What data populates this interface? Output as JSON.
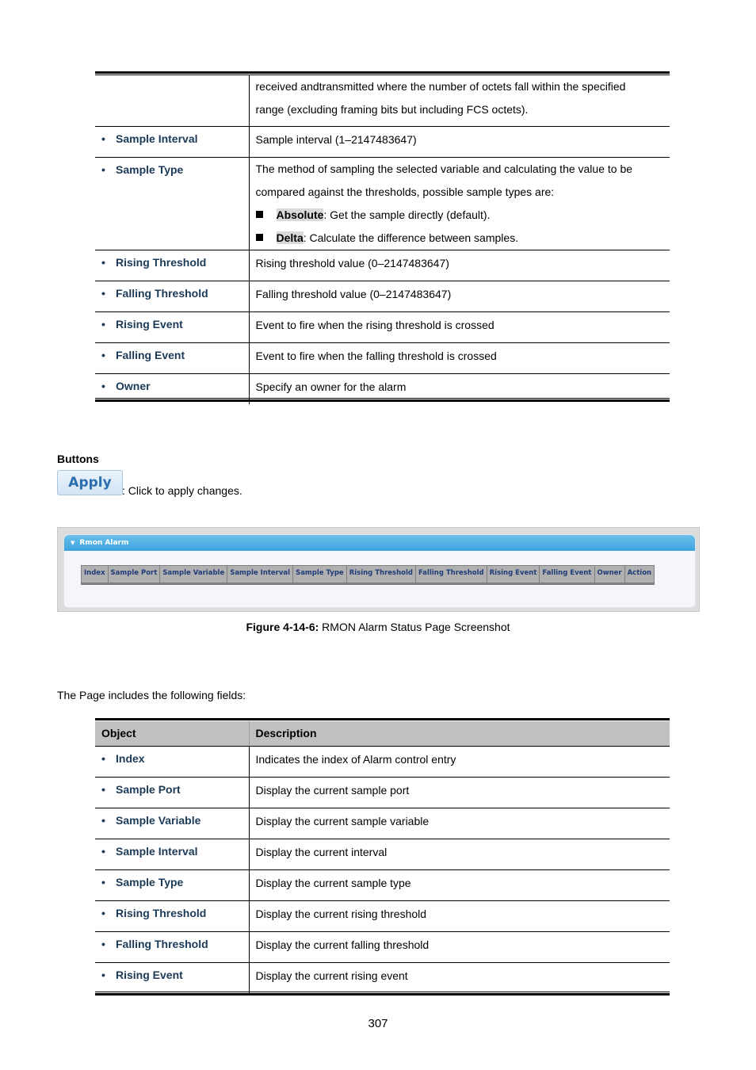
{
  "table1": {
    "continuation": {
      "lines": [
        "received andtransmitted where the number of octets fall within the specified",
        "range (excluding framing bits but including FCS octets)."
      ]
    },
    "rows": [
      {
        "object": "Sample Interval",
        "description": "Sample interval (1–2147483647)"
      },
      {
        "object": "Sample Type",
        "description_lines": [
          "The method of sampling the selected variable and calculating the value to be",
          "compared against the thresholds, possible sample types are:"
        ],
        "options": [
          {
            "name": "Absolute",
            "text": ": Get the sample directly (default)."
          },
          {
            "name": "Delta",
            "text": ": Calculate the difference between samples."
          }
        ]
      },
      {
        "object": "Rising Threshold",
        "description": "Rising threshold value (0–2147483647)"
      },
      {
        "object": "Falling Threshold",
        "description": "Falling threshold value (0–2147483647)"
      },
      {
        "object": "Rising Event",
        "description": "Event to fire when the rising threshold is crossed"
      },
      {
        "object": "Falling Event",
        "description": "Event to fire when the falling threshold is crossed"
      },
      {
        "object": "Owner",
        "description": "Specify an owner for the alarm"
      }
    ]
  },
  "buttons_section": {
    "heading": "Buttons",
    "apply_label": "Apply",
    "apply_desc": ": Click to apply changes."
  },
  "figure": {
    "panel_title": "Rmon Alarm",
    "columns": [
      "Index",
      "Sample Port",
      "Sample Variable",
      "Sample Interval",
      "Sample Type",
      "Rising Threshold",
      "Falling Threshold",
      "Rising Event",
      "Falling Event",
      "Owner",
      "Action"
    ],
    "caption_label": "Figure 4-14-6:",
    "caption_text": " RMON Alarm Status Page Screenshot"
  },
  "intro": "The Page includes the following fields:",
  "table2": {
    "headers": [
      "Object",
      "Description"
    ],
    "rows": [
      {
        "object": "Index",
        "description": "Indicates the index of Alarm control entry"
      },
      {
        "object": "Sample Port",
        "description": "Display the current sample port"
      },
      {
        "object": "Sample Variable",
        "description": "Display the current sample variable"
      },
      {
        "object": "Sample Interval",
        "description": "Display the current interval"
      },
      {
        "object": "Sample Type",
        "description": "Display the current sample type"
      },
      {
        "object": "Rising Threshold",
        "description": "Display the current rising threshold"
      },
      {
        "object": "Falling Threshold",
        "description": "Display the current falling threshold"
      },
      {
        "object": "Rising Event",
        "description": "Display the current rising event"
      }
    ]
  },
  "page_number": "307"
}
